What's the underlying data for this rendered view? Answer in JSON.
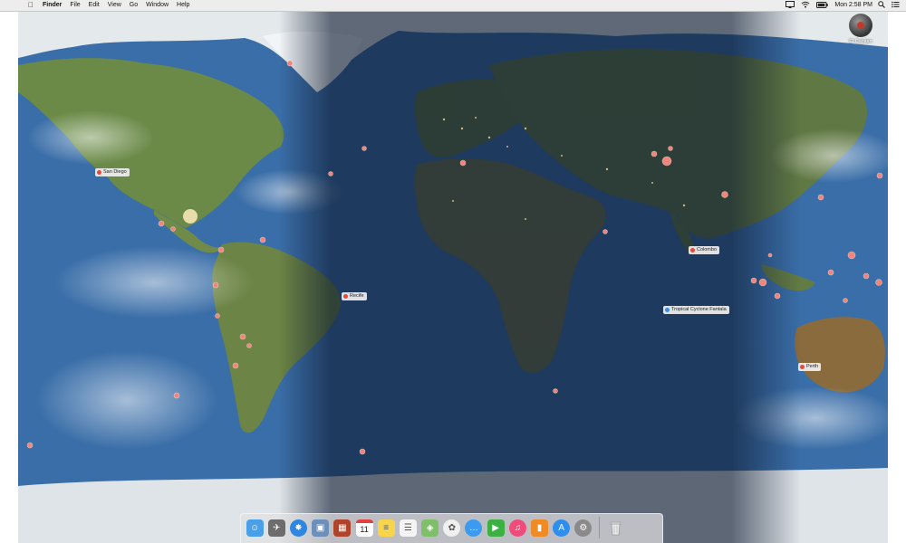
{
  "menubar": {
    "apple_icon": "apple-logo-icon",
    "items": [
      "Finder",
      "File",
      "Edit",
      "View",
      "Go",
      "Window",
      "Help"
    ],
    "status_icons": [
      "display-mirror-icon",
      "wifi-icon",
      "battery-icon"
    ],
    "clock": "Mon 2:58 PM",
    "right_icons": [
      "spotlight-icon",
      "notification-center-icon"
    ]
  },
  "desktop": {
    "volume_label": "El Capitan"
  },
  "map": {
    "labels": {
      "san_diego": "San Diego",
      "recife": "Recife",
      "colombo": "Colombo",
      "cyclone": "Tropical Cyclone Fantala",
      "perth": "Perth"
    },
    "colors": {
      "ocean_day": "#3a6ea8",
      "ocean_night": "#1c2e4a",
      "land_day": "#5f7a3d",
      "land_night": "#2f3a2c",
      "ice": "#e8edf0",
      "event_dot": "#e8483a",
      "cyclone_dot": "#3b8ee8"
    }
  },
  "dock": {
    "apps": [
      {
        "name": "Finder",
        "icon": "finder-icon",
        "color": "#4aa0e8"
      },
      {
        "name": "Launchpad",
        "icon": "rocket-icon",
        "color": "#6d6d6d"
      },
      {
        "name": "Safari",
        "icon": "compass-icon",
        "color": "#2f86e0"
      },
      {
        "name": "Preview",
        "icon": "photo-icon",
        "color": "#6d8fb8"
      },
      {
        "name": "Photo Booth",
        "icon": "photo-booth-icon",
        "color": "#b0442b"
      },
      {
        "name": "Calendar",
        "icon": "calendar-icon",
        "color": "#ffffff",
        "text": "11"
      },
      {
        "name": "Notes",
        "icon": "notes-icon",
        "color": "#f6d54a"
      },
      {
        "name": "Reminders",
        "icon": "reminders-icon",
        "color": "#f4f4f4"
      },
      {
        "name": "Maps",
        "icon": "map-icon",
        "color": "#7fbf6a"
      },
      {
        "name": "Photos",
        "icon": "photos-icon",
        "color": "#f0f0f0"
      },
      {
        "name": "Messages",
        "icon": "messages-icon",
        "color": "#3b9bf0"
      },
      {
        "name": "FaceTime",
        "icon": "facetime-icon",
        "color": "#3cb043"
      },
      {
        "name": "iTunes",
        "icon": "music-note-icon",
        "color": "#f04b7a"
      },
      {
        "name": "iBooks",
        "icon": "book-icon",
        "color": "#f08a24"
      },
      {
        "name": "App Store",
        "icon": "app-store-icon",
        "color": "#2d8ef0"
      },
      {
        "name": "System Preferences",
        "icon": "gear-icon",
        "color": "#8a8a8a"
      }
    ],
    "trash": {
      "name": "Trash",
      "icon": "trash-icon"
    }
  }
}
